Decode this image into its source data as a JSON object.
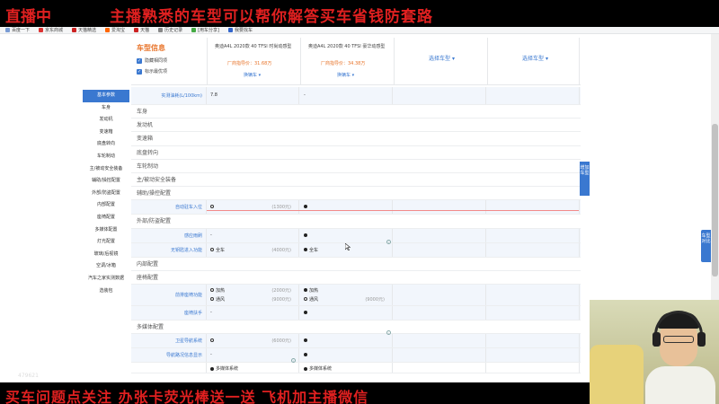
{
  "stream": {
    "live_label": "直播中",
    "top_slogan": "主播熟悉的车型可以帮你解答买车省钱防套路",
    "bottom_message": "买车问题点关注  办张卡荧光棒送一送  飞机加主播微信",
    "viewer_count": "479621"
  },
  "bookmarks": [
    {
      "label": "百度一下",
      "icon": "baidu-icon"
    },
    {
      "label": "京东商城",
      "icon": "jd-icon"
    },
    {
      "label": "天猫精选",
      "icon": "tmall-icon"
    },
    {
      "label": "爱淘宝",
      "icon": "taobao-icon"
    },
    {
      "label": "天猫",
      "icon": "tmall-icon"
    },
    {
      "label": "历史记录",
      "icon": "history-icon"
    },
    {
      "label": "[用车分享]",
      "icon": "share-icon"
    },
    {
      "label": "我要找车",
      "icon": "car-icon"
    }
  ],
  "selector": {
    "title": "车型信息",
    "options": [
      {
        "label": "隐藏相同项",
        "checked": true
      },
      {
        "label": "标示最优项",
        "checked": true
      }
    ]
  },
  "cars": [
    {
      "name": "奥迪A4L 2020款 40 TFSI 时尚动感型",
      "price": "厂商指导价：31.68万",
      "change_label": "换辆车"
    },
    {
      "name": "奥迪A4L 2020款 40 TFSI 豪华动感型",
      "price": "厂商指导价：34.38万",
      "change_label": "换辆车"
    },
    {
      "pick_label": "选择车型"
    },
    {
      "pick_label": "选择车型"
    }
  ],
  "nav": {
    "items": [
      {
        "label": "基本参数",
        "active": true
      },
      {
        "label": "车身"
      },
      {
        "label": "发动机"
      },
      {
        "label": "变速箱"
      },
      {
        "label": "底盘转向"
      },
      {
        "label": "车轮制动"
      },
      {
        "label": "主/被动安全装备"
      },
      {
        "label": "辅助/操控配置"
      },
      {
        "label": "外部/防盗配置"
      },
      {
        "label": "内部配置"
      },
      {
        "label": "座椅配置"
      },
      {
        "label": "多媒体配置"
      },
      {
        "label": "灯光配置"
      },
      {
        "label": "玻璃/后视镜"
      },
      {
        "label": "空调/冰箱"
      },
      {
        "label": "汽车之家实测数据"
      },
      {
        "label": "选装包"
      }
    ]
  },
  "spec": {
    "fuel_row": {
      "label": "实测油耗(L/100km)",
      "car1": "7.8",
      "car2": "-"
    },
    "sections_top": [
      "车身",
      "发动机",
      "变速箱",
      "底盘转向",
      "车轮制动",
      "主/被动安全装备",
      "辅助/操控配置"
    ],
    "auto_park": {
      "label": "自动驻车入位",
      "car1_price": "(1300元)"
    },
    "section_exterior": "外部/防盗配置",
    "sensor_wiper": {
      "label": "感应雨刷",
      "car1": "-"
    },
    "keyless": {
      "label": "无钥匙进入功能",
      "car1": "全车",
      "car1_price": "(4000元)",
      "car2": "全车"
    },
    "section_interior": "内部配置",
    "section_seats": "座椅配置",
    "seat_func": {
      "label": "前排座椅功能",
      "car1_lines": [
        {
          "text": "加热",
          "price": "(2000元)"
        },
        {
          "text": "通风",
          "price": "(9000元)"
        }
      ],
      "car2_lines": [
        {
          "text": "加热"
        },
        {
          "text": "通风",
          "price": "(9000元)"
        }
      ]
    },
    "armrest": {
      "label": "座椅扶手",
      "car1": "-"
    },
    "section_media": "多媒体配置",
    "gps": {
      "label": "卫星导航系统",
      "car1_price": "(6000元)"
    },
    "nav_traffic": {
      "label": "导航路况信息显示",
      "car1": "-"
    },
    "media_sys": {
      "car1": "多媒体系统",
      "car2": "多媒体系统"
    }
  },
  "floating": {
    "compare_tab": "增加车型",
    "side_tab": "车型对比"
  },
  "colors": {
    "accent_blue": "#3a78d0",
    "accent_orange": "#e8742a",
    "banner_red": "#e02020"
  }
}
